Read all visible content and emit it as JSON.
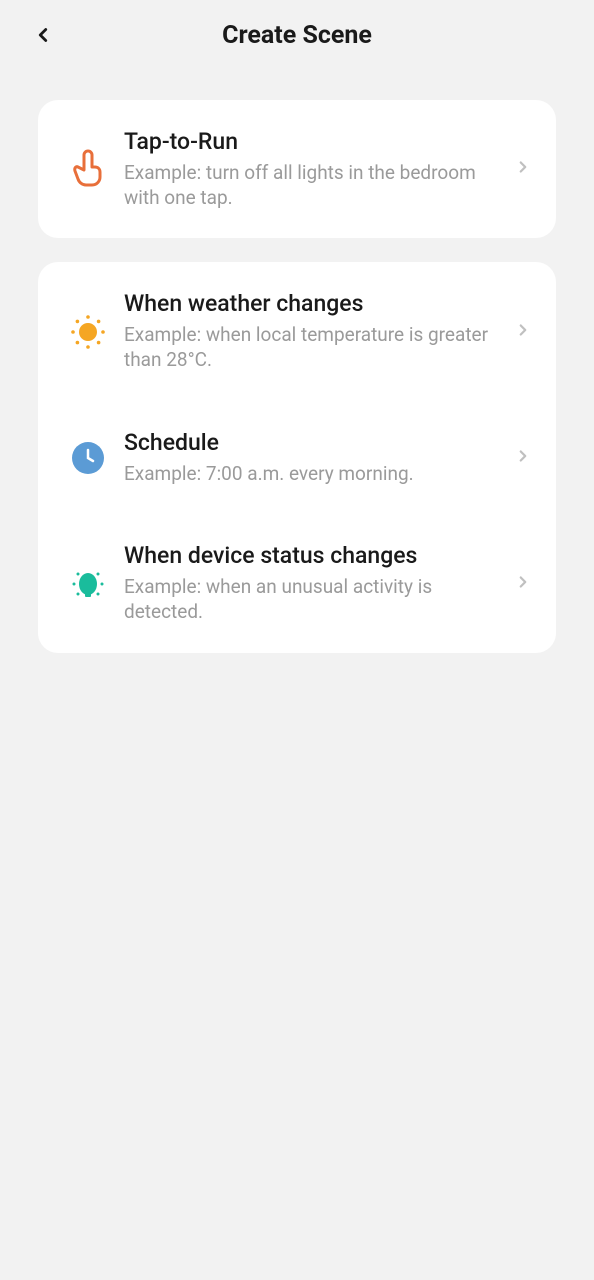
{
  "header": {
    "title": "Create Scene"
  },
  "groups": [
    {
      "items": [
        {
          "title": "Tap-to-Run",
          "example": "Example: turn off all lights in the bedroom with one tap.",
          "icon": "tap-icon"
        }
      ]
    },
    {
      "items": [
        {
          "title": "When weather changes",
          "example": "Example: when local temperature is greater than 28°C.",
          "icon": "sun-icon"
        },
        {
          "title": "Schedule",
          "example": "Example: 7:00 a.m. every morning.",
          "icon": "clock-icon"
        },
        {
          "title": "When device status changes",
          "example": "Example: when an unusual activity is detected.",
          "icon": "bulb-icon"
        }
      ]
    }
  ]
}
